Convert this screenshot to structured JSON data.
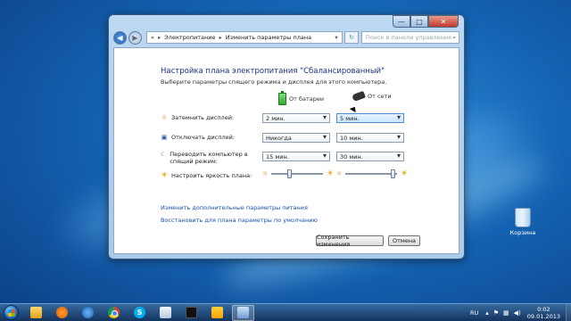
{
  "window": {
    "title_buttons": {
      "minimize": "—",
      "maximize": "□",
      "close": "✕"
    },
    "nav": {
      "back": "◀",
      "forward": "▶"
    },
    "breadcrumb": [
      "Электропитание",
      "Изменить параметры плана"
    ],
    "breadcrumb_prefix": "«",
    "breadcrumb_sep": "▸",
    "search_placeholder": "Поиск в панели управления"
  },
  "page": {
    "title": "Настройка плана электропитания \"Сбалансированный\"",
    "subtitle": "Выберите параметры спящего режима и дисплея для этого компьютера.",
    "col_battery": "От батареи",
    "col_ac": "От сети"
  },
  "settings": [
    {
      "label": "Затемнить дисплей:",
      "battery": "2 мин.",
      "ac": "5 мин."
    },
    {
      "label": "Отключать дисплей:",
      "battery": "Никогда",
      "ac": "10 мин."
    },
    {
      "label": "Переводить компьютер в спящий режим:",
      "battery": "15 мин.",
      "ac": "30 мин."
    },
    {
      "label": "Настроить яркость плана:"
    }
  ],
  "brightness": {
    "battery": 0.35,
    "ac": 0.95
  },
  "links": {
    "advanced": "Изменить дополнительные параметры питания",
    "restore": "Восстановить для плана параметры по умолчанию"
  },
  "buttons": {
    "save": "Сохранить изменения",
    "cancel": "Отмена"
  },
  "desktop": {
    "recycle_bin": "Корзина"
  },
  "taskbar": {
    "pinned": [
      "folder-icon",
      "media-center-icon",
      "windows-media-player-icon",
      "chrome-icon",
      "skype-icon",
      "documents-icon",
      "command-prompt-icon",
      "game-icon",
      "control-panel-icon"
    ],
    "skype_glyph": "S",
    "language": "RU",
    "time": "0:02",
    "date": "09.01.2013"
  }
}
